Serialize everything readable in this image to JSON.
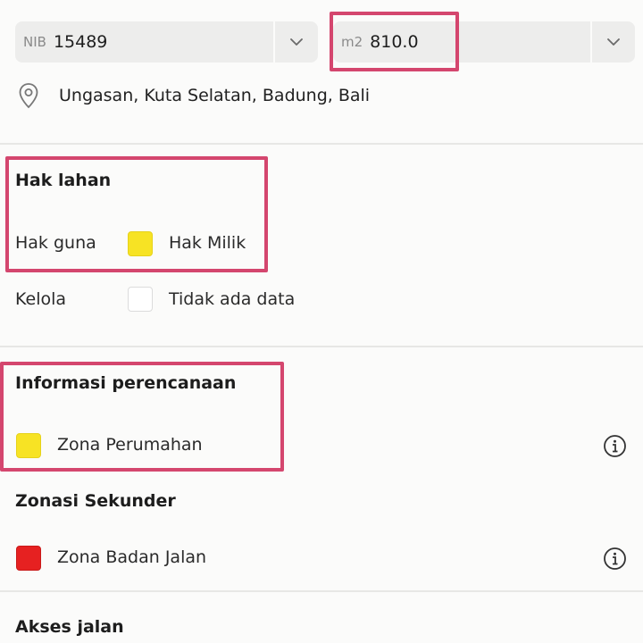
{
  "nib_field": {
    "prefix": "NIB",
    "value": "15489"
  },
  "area_field": {
    "prefix": "m2",
    "value": "810.0"
  },
  "location": {
    "address": "Ungasan, Kuta Selatan, Badung, Bali"
  },
  "land_rights": {
    "heading": "Hak lahan",
    "rows": [
      {
        "label": "Hak guna",
        "value": "Hak Milik",
        "color": "#f7e324"
      },
      {
        "label": "Kelola",
        "value": "Tidak ada data",
        "color": "#ffffff"
      }
    ]
  },
  "planning": {
    "heading": "Informasi perencanaan",
    "zone": {
      "label": "Zona Perumahan",
      "color": "#f7e324"
    }
  },
  "secondary_zoning": {
    "heading": "Zonasi Sekunder",
    "zone": {
      "label": "Zona Badan Jalan",
      "color": "#e62121"
    }
  },
  "road_access": {
    "heading": "Akses jalan"
  },
  "highlight_color": "#d4466e"
}
